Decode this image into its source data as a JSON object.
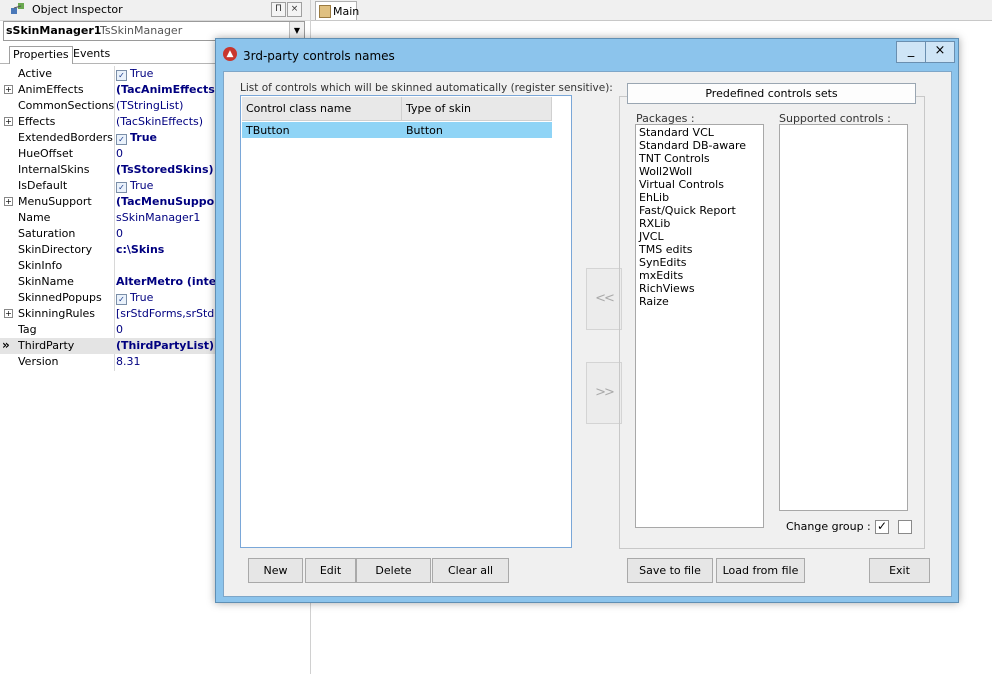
{
  "object_inspector": {
    "title": "Object Inspector",
    "pin": "П",
    "close": "×",
    "component_name": "sSkinManager1",
    "component_class": "TsSkinManager",
    "tabs": [
      "Properties",
      "Events"
    ],
    "properties": [
      {
        "name": "Active",
        "value": "True",
        "check": true,
        "bold": false,
        "expand": false
      },
      {
        "name": "AnimEffects",
        "value": "(TacAnimEffects)",
        "check": false,
        "bold": true,
        "expand": true
      },
      {
        "name": "CommonSections",
        "value": "(TStringList)",
        "check": false,
        "bold": false,
        "expand": false
      },
      {
        "name": "Effects",
        "value": "(TacSkinEffects)",
        "check": false,
        "bold": false,
        "expand": true
      },
      {
        "name": "ExtendedBorders",
        "value": "True",
        "check": true,
        "bold": true,
        "expand": false
      },
      {
        "name": "HueOffset",
        "value": "0",
        "check": false,
        "bold": false,
        "expand": false
      },
      {
        "name": "InternalSkins",
        "value": "(TsStoredSkins)",
        "check": false,
        "bold": true,
        "expand": false
      },
      {
        "name": "IsDefault",
        "value": "True",
        "check": true,
        "bold": false,
        "expand": false
      },
      {
        "name": "MenuSupport",
        "value": "(TacMenuSupport)",
        "check": false,
        "bold": true,
        "expand": true
      },
      {
        "name": "Name",
        "value": "sSkinManager1",
        "check": false,
        "bold": false,
        "expand": false
      },
      {
        "name": "Saturation",
        "value": "0",
        "check": false,
        "bold": false,
        "expand": false
      },
      {
        "name": "SkinDirectory",
        "value": "c:\\Skins",
        "check": false,
        "bold": true,
        "expand": false
      },
      {
        "name": "SkinInfo",
        "value": "",
        "check": false,
        "bold": false,
        "expand": false
      },
      {
        "name": "SkinName",
        "value": "AlterMetro (internal)",
        "check": false,
        "bold": true,
        "expand": false
      },
      {
        "name": "SkinnedPopups",
        "value": "True",
        "check": true,
        "bold": false,
        "expand": false
      },
      {
        "name": "SkinningRules",
        "value": "[srStdForms,srStdDialogs]",
        "check": false,
        "bold": false,
        "expand": true
      },
      {
        "name": "Tag",
        "value": "0",
        "check": false,
        "bold": false,
        "expand": false
      },
      {
        "name": "ThirdParty",
        "value": "(ThirdPartyList)",
        "check": false,
        "bold": true,
        "expand": false,
        "selected": true
      },
      {
        "name": "Version",
        "value": "8.31",
        "check": false,
        "bold": false,
        "expand": false
      }
    ]
  },
  "main_tab": "Main",
  "dialog": {
    "title": "3rd-party controls names",
    "minimize": "_",
    "close": "×",
    "list_label": "List of controls which will be skinned automatically (register sensitive):",
    "columns": [
      "Control class name",
      "Type of skin"
    ],
    "rows": [
      [
        "TButton",
        "Button"
      ]
    ],
    "add_arrow": "<<",
    "remove_arrow": ">>",
    "predefined_caption": "Predefined controls sets",
    "packages_label": "Packages :",
    "supported_label": "Supported controls :",
    "packages": [
      "Standard VCL",
      "Standard DB-aware",
      "TNT Controls",
      "Woll2Woll",
      "Virtual Controls",
      "EhLib",
      "Fast/Quick Report",
      "RXLib",
      "JVCL",
      "TMS edits",
      "SynEdits",
      "mxEdits",
      "RichViews",
      "Raize"
    ],
    "change_group_label": "Change group :",
    "check_mark": "✓",
    "buttons": {
      "new": "New",
      "edit": "Edit",
      "delete": "Delete",
      "clear_all": "Clear all",
      "save_to_file": "Save to file",
      "load_from_file": "Load from file",
      "exit": "Exit"
    }
  }
}
